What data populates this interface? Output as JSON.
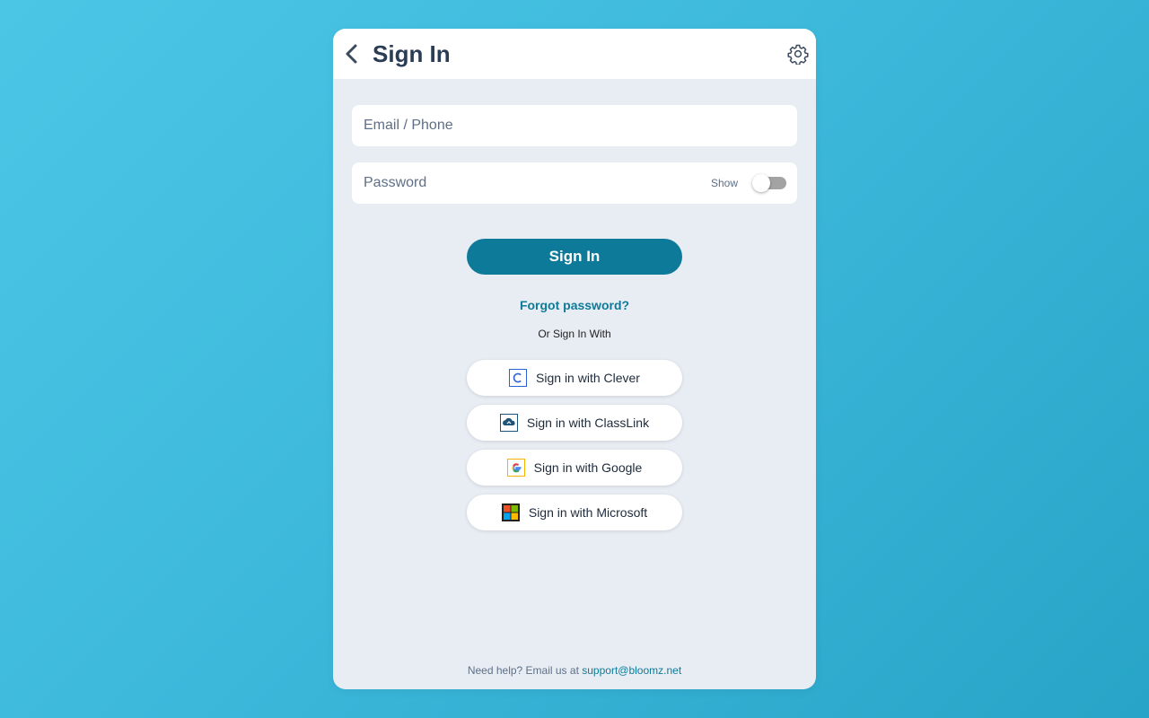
{
  "header": {
    "title": "Sign In",
    "back_icon": "chevron-left-icon",
    "settings_icon": "gear-icon"
  },
  "form": {
    "email_placeholder": "Email / Phone",
    "email_value": "",
    "password_placeholder": "Password",
    "password_value": "",
    "show_label": "Show",
    "show_toggle_on": false,
    "signin_label": "Sign In",
    "forgot_label": "Forgot password?"
  },
  "sso": {
    "divider_text": "Or Sign In With",
    "buttons": [
      {
        "label": "Sign in with Clever",
        "icon": "clever-icon"
      },
      {
        "label": "Sign in with ClassLink",
        "icon": "classlink-icon"
      },
      {
        "label": "Sign in with Google",
        "icon": "google-icon"
      },
      {
        "label": "Sign in with Microsoft",
        "icon": "microsoft-icon"
      }
    ]
  },
  "footer": {
    "help_text": "Need help? Email us at",
    "support_email": "support@bloomz.net"
  },
  "colors": {
    "primary": "#0e7a99",
    "title": "#2b3d55",
    "card_bg": "#e8edf4",
    "page_bg_start": "#4cc6e5",
    "page_bg_end": "#27a4c7"
  }
}
